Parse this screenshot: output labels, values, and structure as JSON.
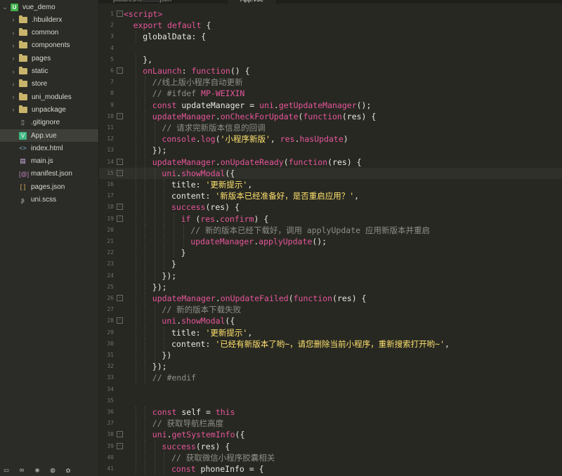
{
  "sidebar": {
    "root": "vue_demo",
    "items": [
      {
        "label": "vue_demo",
        "type": "root",
        "expandable": true
      },
      {
        "label": ".hbuilderx",
        "type": "folder",
        "expandable": true
      },
      {
        "label": "common",
        "type": "folder",
        "expandable": true
      },
      {
        "label": "components",
        "type": "folder",
        "expandable": true
      },
      {
        "label": "pages",
        "type": "folder",
        "expandable": true
      },
      {
        "label": "static",
        "type": "folder",
        "expandable": true
      },
      {
        "label": "store",
        "type": "folder",
        "expandable": true
      },
      {
        "label": "uni_modules",
        "type": "folder",
        "expandable": true
      },
      {
        "label": "unpackage",
        "type": "folder",
        "expandable": true
      },
      {
        "label": ".gitignore",
        "type": "file",
        "icon": "gitignore-file-icon"
      },
      {
        "label": "App.vue",
        "type": "file",
        "icon": "vue-file-icon",
        "selected": true
      },
      {
        "label": "index.html",
        "type": "file",
        "icon": "html-file-icon"
      },
      {
        "label": "main.js",
        "type": "file",
        "icon": "js-file-icon"
      },
      {
        "label": "manifest.json",
        "type": "file",
        "icon": "manifest-file-icon"
      },
      {
        "label": "pages.json",
        "type": "file",
        "icon": "json-file-icon"
      },
      {
        "label": "uni.scss",
        "type": "file",
        "icon": "scss-file-icon"
      }
    ],
    "bottom_icons": [
      "folder-icon",
      "binoculars-icon",
      "bug-icon",
      "globe-icon",
      "palette-icon"
    ]
  },
  "tabs": [
    {
      "label": "pictures/f9..........json",
      "active": false
    },
    {
      "label": "App.vue",
      "active": true
    }
  ],
  "editor": {
    "current_line": 15,
    "lines": [
      {
        "n": "1",
        "fold": "-",
        "indent": 0,
        "tokens": [
          [
            "kw",
            "<script>"
          ]
        ]
      },
      {
        "n": "2",
        "fold": "",
        "indent": 1,
        "tokens": [
          [
            "kw",
            "export default"
          ],
          [
            "",
            "{"
          ]
        ]
      },
      {
        "n": "3",
        "fold": "",
        "indent": 2,
        "tokens": [
          [
            "",
            "globalData: {"
          ]
        ]
      },
      {
        "n": "4",
        "fold": "",
        "indent": 0,
        "tokens": []
      },
      {
        "n": "5",
        "fold": "",
        "indent": 2,
        "tokens": [
          [
            "",
            "},"
          ]
        ]
      },
      {
        "n": "6",
        "fold": "-",
        "indent": 2,
        "tokens": [
          [
            "fn",
            "onLaunch"
          ],
          [
            "",
            ": "
          ],
          [
            "kw",
            "function"
          ],
          [
            "",
            "() {"
          ]
        ]
      },
      {
        "n": "7",
        "fold": "",
        "indent": 3,
        "tokens": [
          [
            "cmt",
            "//线上版小程序自动更新"
          ]
        ]
      },
      {
        "n": "8",
        "fold": "",
        "indent": 3,
        "tokens": [
          [
            "cmt",
            "// #ifdef "
          ],
          [
            "kw",
            "MP-WEIXIN"
          ]
        ]
      },
      {
        "n": "9",
        "fold": "",
        "indent": 3,
        "tokens": [
          [
            "kw",
            "const"
          ],
          [
            "",
            " updateManager = "
          ],
          [
            "fn",
            "uni"
          ],
          [
            "",
            "."
          ],
          [
            "fn",
            "getUpdateManager"
          ],
          [
            "",
            "();"
          ]
        ]
      },
      {
        "n": "10",
        "fold": "-",
        "indent": 3,
        "tokens": [
          [
            "fn",
            "updateManager"
          ],
          [
            "",
            "."
          ],
          [
            "fn",
            "onCheckForUpdate"
          ],
          [
            "",
            "("
          ],
          [
            "kw",
            "function"
          ],
          [
            "",
            "(res) {"
          ]
        ]
      },
      {
        "n": "11",
        "fold": "",
        "indent": 4,
        "tokens": [
          [
            "cmt",
            "// 请求完新版本信息的回调"
          ]
        ]
      },
      {
        "n": "12",
        "fold": "",
        "indent": 4,
        "tokens": [
          [
            "fn",
            "console"
          ],
          [
            "",
            "."
          ],
          [
            "fn",
            "log"
          ],
          [
            "",
            "("
          ],
          [
            "str",
            "'小程序新版'"
          ],
          [
            "",
            ", "
          ],
          [
            "fn",
            "res"
          ],
          [
            "",
            "."
          ],
          [
            "fn",
            "hasUpdate"
          ],
          [
            "",
            ")"
          ]
        ]
      },
      {
        "n": "13",
        "fold": "",
        "indent": 3,
        "tokens": [
          [
            "",
            "});"
          ]
        ]
      },
      {
        "n": "14",
        "fold": "-",
        "indent": 3,
        "tokens": [
          [
            "fn",
            "updateManager"
          ],
          [
            "",
            "."
          ],
          [
            "fn",
            "onUpdateReady"
          ],
          [
            "",
            "("
          ],
          [
            "kw",
            "function"
          ],
          [
            "",
            "(res) {"
          ]
        ]
      },
      {
        "n": "15",
        "fold": "-",
        "indent": 4,
        "tokens": [
          [
            "fn",
            "uni"
          ],
          [
            "",
            "."
          ],
          [
            "fn",
            "showModal"
          ],
          [
            "",
            "({"
          ]
        ]
      },
      {
        "n": "16",
        "fold": "",
        "indent": 5,
        "tokens": [
          [
            "",
            "title: "
          ],
          [
            "str",
            "'更新提示'"
          ],
          [
            "",
            ","
          ]
        ]
      },
      {
        "n": "17",
        "fold": "",
        "indent": 5,
        "tokens": [
          [
            "",
            "content: "
          ],
          [
            "str",
            "'新版本已经准备好，是否重启应用？'"
          ],
          [
            "",
            ","
          ]
        ]
      },
      {
        "n": "18",
        "fold": "-",
        "indent": 5,
        "tokens": [
          [
            "fn",
            "success"
          ],
          [
            "",
            "(res) {"
          ]
        ]
      },
      {
        "n": "19",
        "fold": "-",
        "indent": 6,
        "tokens": [
          [
            "kw",
            "if"
          ],
          [
            "",
            " ("
          ],
          [
            "fn",
            "res"
          ],
          [
            "",
            "."
          ],
          [
            "fn",
            "confirm"
          ],
          [
            "",
            ") {"
          ]
        ]
      },
      {
        "n": "20",
        "fold": "",
        "indent": 7,
        "tokens": [
          [
            "cmt",
            "// 新的版本已经下载好，调用 applyUpdate 应用新版本并重启"
          ]
        ]
      },
      {
        "n": "21",
        "fold": "",
        "indent": 7,
        "tokens": [
          [
            "fn",
            "updateManager"
          ],
          [
            "",
            "."
          ],
          [
            "fn",
            "applyUpdate"
          ],
          [
            "",
            "();"
          ]
        ]
      },
      {
        "n": "22",
        "fold": "",
        "indent": 6,
        "tokens": [
          [
            "",
            "}"
          ]
        ]
      },
      {
        "n": "23",
        "fold": "",
        "indent": 5,
        "tokens": [
          [
            "",
            "}"
          ]
        ]
      },
      {
        "n": "24",
        "fold": "",
        "indent": 4,
        "tokens": [
          [
            "",
            "});"
          ]
        ]
      },
      {
        "n": "25",
        "fold": "",
        "indent": 3,
        "tokens": [
          [
            "",
            "});"
          ]
        ]
      },
      {
        "n": "26",
        "fold": "-",
        "indent": 3,
        "tokens": [
          [
            "fn",
            "updateManager"
          ],
          [
            "",
            "."
          ],
          [
            "fn",
            "onUpdateFailed"
          ],
          [
            "",
            "("
          ],
          [
            "kw",
            "function"
          ],
          [
            "",
            "(res) {"
          ]
        ]
      },
      {
        "n": "27",
        "fold": "",
        "indent": 4,
        "tokens": [
          [
            "cmt",
            "// 新的版本下载失败"
          ]
        ]
      },
      {
        "n": "28",
        "fold": "-",
        "indent": 4,
        "tokens": [
          [
            "fn",
            "uni"
          ],
          [
            "",
            "."
          ],
          [
            "fn",
            "showModal"
          ],
          [
            "",
            "({"
          ]
        ]
      },
      {
        "n": "29",
        "fold": "",
        "indent": 5,
        "tokens": [
          [
            "",
            "title: "
          ],
          [
            "str",
            "'更新提示'"
          ],
          [
            "",
            ","
          ]
        ]
      },
      {
        "n": "30",
        "fold": "",
        "indent": 5,
        "tokens": [
          [
            "",
            "content: "
          ],
          [
            "str",
            "'已经有新版本了哟~，请您删除当前小程序，重新搜索打开哟~'"
          ],
          [
            "",
            ","
          ]
        ]
      },
      {
        "n": "31",
        "fold": "",
        "indent": 4,
        "tokens": [
          [
            "",
            "})"
          ]
        ]
      },
      {
        "n": "32",
        "fold": "",
        "indent": 3,
        "tokens": [
          [
            "",
            "});"
          ]
        ]
      },
      {
        "n": "33",
        "fold": "",
        "indent": 3,
        "tokens": [
          [
            "cmt",
            "// #endif"
          ]
        ]
      },
      {
        "n": "34",
        "fold": "",
        "indent": 0,
        "tokens": []
      },
      {
        "n": "35",
        "fold": "",
        "indent": 0,
        "tokens": []
      },
      {
        "n": "36",
        "fold": "",
        "indent": 3,
        "tokens": [
          [
            "kw",
            "const"
          ],
          [
            "",
            " self = "
          ],
          [
            "kw",
            "this"
          ]
        ]
      },
      {
        "n": "37",
        "fold": "",
        "indent": 3,
        "tokens": [
          [
            "cmt",
            "// 获取导航栏高度"
          ]
        ]
      },
      {
        "n": "38",
        "fold": "-",
        "indent": 3,
        "tokens": [
          [
            "fn",
            "uni"
          ],
          [
            "",
            "."
          ],
          [
            "fn",
            "getSystemInfo"
          ],
          [
            "",
            "({"
          ]
        ]
      },
      {
        "n": "39",
        "fold": "-",
        "indent": 4,
        "tokens": [
          [
            "fn",
            "success"
          ],
          [
            "",
            "(res) {"
          ]
        ]
      },
      {
        "n": "40",
        "fold": "",
        "indent": 5,
        "tokens": [
          [
            "cmt",
            "// 获取微信小程序胶囊相关"
          ]
        ]
      },
      {
        "n": "41",
        "fold": "",
        "indent": 5,
        "tokens": [
          [
            "kw",
            "const"
          ],
          [
            "",
            " phoneInfo = {"
          ]
        ]
      }
    ]
  }
}
